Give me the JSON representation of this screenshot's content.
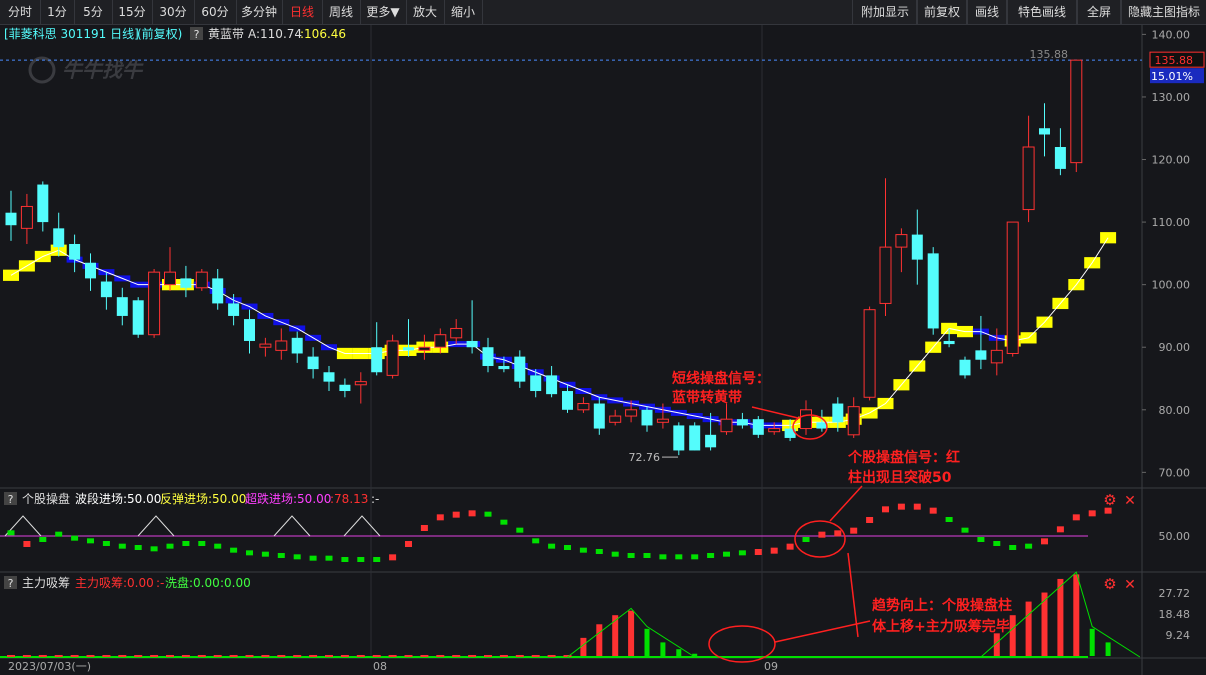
{
  "toolbar": {
    "left": [
      "分时",
      "1分",
      "5分",
      "15分",
      "30分",
      "60分",
      "多分钟",
      "日线",
      "周线",
      "更多▼",
      "放大",
      "缩小"
    ],
    "active": "日线",
    "right": [
      "附加显示",
      "前复权",
      "画线",
      "特色画线",
      "全屏",
      "隐藏主图指标"
    ]
  },
  "header": {
    "stock": "[菲菱科思 301191 日线]",
    "adj": "(前复权)",
    "help": "?",
    "indicator": "黄蓝带",
    "a_label": "A:110.74",
    "b_label": ":106.46",
    "watermark": "牛牛找牛"
  },
  "price_axis": {
    "ticks": [
      "140.00",
      "130.00",
      "120.00",
      "110.00",
      "100.00",
      "90.00",
      "80.00",
      "70.00"
    ],
    "min": 67.5,
    "max": 141.5
  },
  "price_tag": {
    "value": "135.88",
    "pct": "15.01%",
    "line_label": "135.88"
  },
  "low_label": "72.76",
  "pane2": {
    "help": "?",
    "name": "个股操盘",
    "s1": "波段进场:50.00",
    "s2": "反弹进场:50.00",
    "s3": "超跌进场:50.00",
    "s4": ":78.13",
    "s5": ":-",
    "tick": "50.00"
  },
  "pane3": {
    "help": "?",
    "name": "主力吸筹",
    "s1": "主力吸筹:0.00",
    "s2": ":-",
    "s3": "洗盘:0.00",
    "s4": ":0.00",
    "ticks": [
      "27.72",
      "18.48",
      "9.24"
    ]
  },
  "date_axis": {
    "first": "2023/07/03(一)",
    "m1": "08",
    "m2": "09"
  },
  "annotations": {
    "a1_l1": "短线操盘信号：",
    "a1_l2": "蓝带转黄带",
    "a2_l1": "个股操盘信号：红",
    "a2_l2": "柱出现且突破50",
    "a3_l1": "趋势向上：个股操盘柱",
    "a3_l2": "体上移+主力吸筹完毕"
  },
  "colors": {
    "up": "#ff3232",
    "down": "#54fcfc",
    "yellow": "#ffff00",
    "blue": "#1010e6",
    "magenta": "#e040e0",
    "green": "#00e000",
    "annot": "#ff2020"
  },
  "chart_data": {
    "type": "candlestick",
    "candles": [
      [
        109.5,
        111.5,
        107,
        115,
        "d"
      ],
      [
        112.5,
        109,
        106.5,
        114.5,
        "u"
      ],
      [
        116,
        110,
        108.5,
        116.5,
        "d"
      ],
      [
        109,
        106,
        104.5,
        111.5,
        "d"
      ],
      [
        106.5,
        104,
        102,
        108,
        "d"
      ],
      [
        103.5,
        101,
        99,
        105,
        "d"
      ],
      [
        100.5,
        98,
        96,
        102,
        "d"
      ],
      [
        98,
        95,
        93.5,
        99.5,
        "d"
      ],
      [
        97.5,
        92,
        91.5,
        98,
        "d"
      ],
      [
        92,
        102,
        91.5,
        102.5,
        "u"
      ],
      [
        100,
        102,
        99,
        106,
        "u"
      ],
      [
        101,
        99.5,
        98,
        103,
        "d"
      ],
      [
        99.5,
        102,
        99,
        102.5,
        "u"
      ],
      [
        101,
        97,
        96,
        102.5,
        "d"
      ],
      [
        97,
        95,
        93.5,
        98.5,
        "d"
      ],
      [
        94.5,
        91,
        89,
        96,
        "d"
      ],
      [
        90,
        90.5,
        88.5,
        91.5,
        "u"
      ],
      [
        89.5,
        91,
        88,
        93,
        "u"
      ],
      [
        91.5,
        89,
        87.5,
        92.5,
        "d"
      ],
      [
        88.5,
        86.5,
        85,
        90,
        "d"
      ],
      [
        86,
        84.5,
        83,
        87,
        "d"
      ],
      [
        83,
        84,
        82,
        85,
        "d"
      ],
      [
        84,
        84.5,
        81,
        86,
        "u"
      ],
      [
        86,
        90,
        85.5,
        94,
        "d"
      ],
      [
        85.5,
        91,
        85,
        92,
        "u"
      ],
      [
        90,
        89.5,
        88.5,
        94.5,
        "d"
      ],
      [
        89.5,
        90,
        88,
        92,
        "u"
      ],
      [
        90,
        92,
        89,
        93,
        "u"
      ],
      [
        91.5,
        93,
        90.5,
        94.5,
        "u"
      ],
      [
        90,
        91,
        89,
        97.5,
        "d"
      ],
      [
        90,
        87,
        86,
        91.5,
        "d"
      ],
      [
        87,
        86.5,
        86,
        88.5,
        "d"
      ],
      [
        88.5,
        84.5,
        83.5,
        89.5,
        "d"
      ],
      [
        85.5,
        83,
        82,
        86.5,
        "d"
      ],
      [
        85.5,
        82.5,
        82,
        87,
        "d"
      ],
      [
        83,
        80,
        79.5,
        84,
        "d"
      ],
      [
        80,
        81,
        79.5,
        82,
        "u"
      ],
      [
        81,
        77,
        76,
        82,
        "d"
      ],
      [
        78,
        79,
        77.5,
        80,
        "u"
      ],
      [
        79,
        80,
        78,
        81.5,
        "u"
      ],
      [
        80,
        77.5,
        76.5,
        80.5,
        "d"
      ],
      [
        78,
        78.5,
        77,
        81,
        "u"
      ],
      [
        77.5,
        73.5,
        72.76,
        78,
        "d"
      ],
      [
        77.5,
        73.5,
        73.5,
        78,
        "d"
      ],
      [
        76,
        74,
        73.5,
        79.5,
        "d"
      ],
      [
        76.5,
        78.5,
        76,
        81,
        "u"
      ],
      [
        78.5,
        77.5,
        77,
        79.5,
        "d"
      ],
      [
        78.5,
        76,
        75.5,
        79,
        "d"
      ],
      [
        76.5,
        77,
        76,
        78,
        "u"
      ],
      [
        77,
        75.5,
        75,
        78.5,
        "d"
      ],
      [
        77,
        80,
        76,
        81.5,
        "u"
      ],
      [
        78,
        77,
        76.5,
        80,
        "d"
      ],
      [
        81,
        78,
        76.5,
        82,
        "d"
      ],
      [
        76,
        80.5,
        75.5,
        82,
        "u"
      ],
      [
        82,
        96,
        81.5,
        96.5,
        "u"
      ],
      [
        97,
        106,
        95,
        117,
        "u"
      ],
      [
        106,
        108,
        102,
        109,
        "u"
      ],
      [
        108,
        104,
        100,
        112,
        "d"
      ],
      [
        105,
        93,
        92,
        106,
        "d"
      ],
      [
        91,
        90.5,
        90,
        93,
        "d"
      ],
      [
        88,
        85.5,
        85,
        88.5,
        "d"
      ],
      [
        89.5,
        88,
        86.5,
        95,
        "d"
      ],
      [
        87.5,
        89.5,
        85.5,
        93,
        "u"
      ],
      [
        89,
        110,
        88.5,
        110,
        "u"
      ],
      [
        112,
        122,
        110,
        127,
        "u"
      ],
      [
        124,
        125,
        120.5,
        129,
        "d"
      ],
      [
        122,
        118.5,
        117.5,
        125,
        "d"
      ],
      [
        119.5,
        135.88,
        118,
        135.88,
        "u"
      ]
    ],
    "band": [
      101.5,
      103,
      104.5,
      105.5,
      104,
      103,
      102,
      101,
      100,
      100,
      100,
      100,
      100,
      99,
      97.5,
      96.5,
      95,
      94,
      93,
      91.5,
      90,
      89,
      89,
      89,
      89.5,
      89.5,
      90,
      90,
      90.5,
      90.5,
      88.5,
      88,
      87,
      86,
      85,
      84,
      83,
      82,
      81.5,
      81,
      80.5,
      80,
      79.5,
      79,
      78.5,
      78,
      78,
      77.5,
      77.5,
      77.5,
      78,
      78,
      78,
      78.5,
      79.5,
      81,
      84,
      87,
      90,
      93,
      92.5,
      92.5,
      91.5,
      91,
      91.5,
      94,
      97,
      100,
      103.5,
      107.5
    ],
    "band_yellow": [
      1,
      1,
      1,
      1,
      0,
      0,
      0,
      0,
      0,
      0,
      1,
      1,
      0,
      0,
      0,
      0,
      0,
      0,
      0,
      0,
      0,
      1,
      1,
      1,
      1,
      1,
      1,
      1,
      0,
      0,
      0,
      0,
      0,
      0,
      0,
      0,
      0,
      0,
      0,
      0,
      0,
      0,
      0,
      0,
      0,
      0,
      0,
      0,
      0,
      1,
      1,
      1,
      1,
      1,
      1,
      1,
      1,
      1,
      1,
      1,
      1,
      0,
      0,
      1,
      1,
      1,
      1,
      1,
      1,
      1
    ],
    "op_values": [
      51,
      47,
      48.5,
      50.5,
      49,
      48,
      47,
      46,
      45.5,
      45,
      46,
      47,
      47,
      46,
      44.5,
      43.5,
      43,
      42.5,
      42,
      41.5,
      41.5,
      41,
      41,
      41,
      42,
      47,
      53,
      57,
      58,
      58.5,
      58,
      55,
      52,
      48,
      46,
      45.5,
      44.5,
      44,
      43,
      42.5,
      42.5,
      42,
      42,
      42,
      42.5,
      43,
      43.5,
      44,
      44.5,
      46,
      48.5,
      50.5,
      51,
      52,
      56,
      60,
      61,
      61,
      59.5,
      56,
      52,
      48.5,
      47,
      45.5,
      46,
      48,
      52.5,
      57,
      58.5,
      59.5
    ],
    "op_red": [
      0,
      1,
      0,
      0,
      0,
      0,
      0,
      0,
      0,
      0,
      0,
      0,
      0,
      0,
      0,
      0,
      0,
      0,
      0,
      0,
      0,
      0,
      0,
      0,
      1,
      1,
      1,
      1,
      1,
      1,
      0,
      0,
      0,
      0,
      0,
      0,
      0,
      0,
      0,
      0,
      0,
      0,
      0,
      0,
      0,
      0,
      0,
      1,
      1,
      1,
      0,
      1,
      1,
      1,
      1,
      1,
      1,
      1,
      1,
      0,
      0,
      0,
      0,
      0,
      0,
      1,
      1,
      1,
      1,
      1
    ],
    "op_ylim": [
      38,
      62
    ],
    "triangles": [
      9,
      18,
      22
    ],
    "main_bars": [
      0,
      0,
      0,
      0,
      0,
      0,
      0,
      0,
      0,
      0,
      0,
      0,
      0,
      0,
      0,
      0,
      0,
      0,
      0,
      0,
      0,
      0,
      0,
      0,
      0,
      0,
      0,
      0,
      0,
      0,
      0,
      0,
      0,
      0,
      0,
      0,
      8,
      14,
      18,
      20,
      0,
      0,
      0,
      0,
      0,
      0,
      0,
      0,
      0,
      0,
      0,
      0,
      0,
      0,
      0,
      0,
      0,
      0,
      0,
      0,
      0,
      0,
      10,
      18,
      24,
      28,
      34,
      36,
      0,
      0
    ],
    "wash": [
      0,
      0,
      0,
      0,
      0,
      0,
      0,
      0,
      0,
      0,
      0,
      0,
      0,
      0,
      0,
      0,
      0,
      0,
      0,
      0,
      0,
      0,
      0,
      0,
      0,
      0,
      0,
      0,
      0,
      0,
      0,
      0,
      0,
      0,
      0,
      0,
      0,
      0,
      0,
      0,
      12,
      6,
      3,
      1,
      0,
      0,
      0,
      0,
      0,
      0,
      0,
      0,
      0,
      0,
      0,
      0,
      0,
      0,
      0,
      0,
      0,
      0,
      0,
      0,
      0,
      0,
      0,
      0,
      12,
      6
    ],
    "xc_start": 11,
    "xc_step": 15.9,
    "main_ylim": [
      0,
      30
    ]
  }
}
